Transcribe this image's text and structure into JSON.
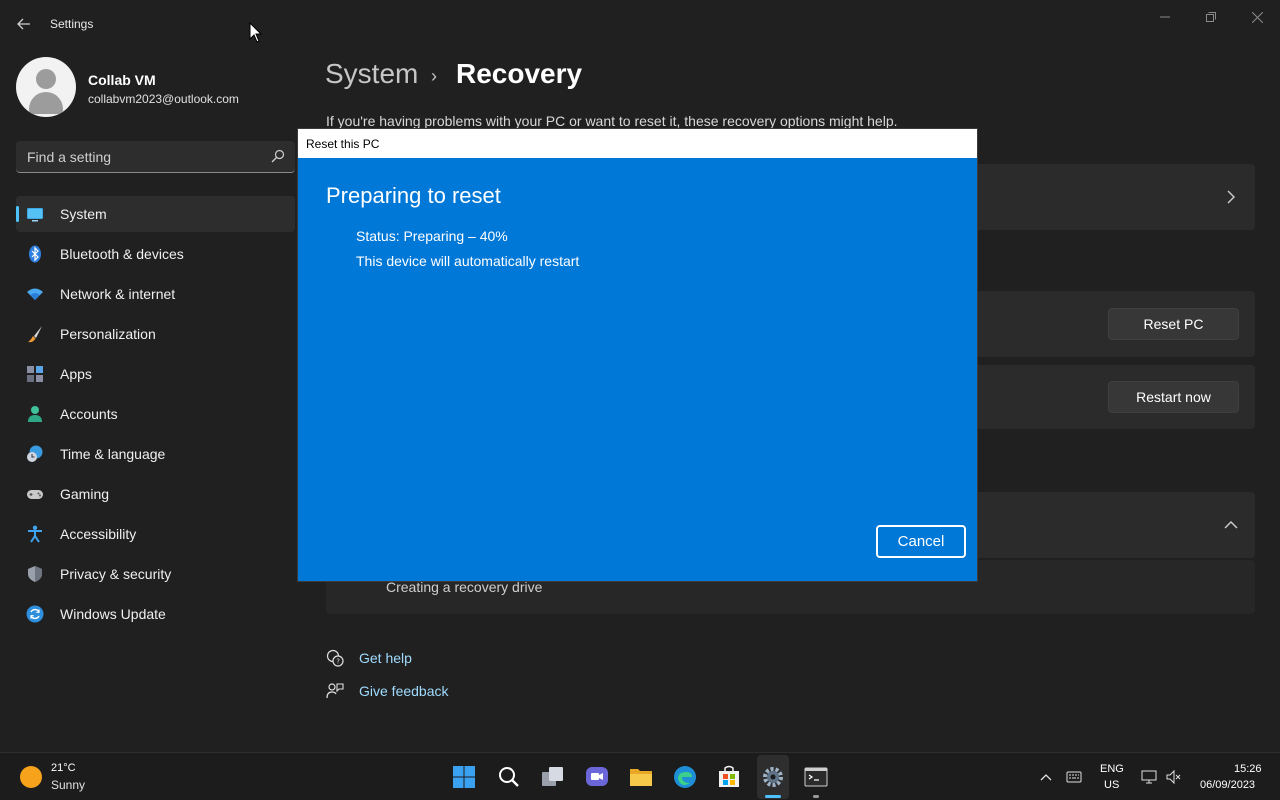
{
  "window": {
    "app_title": "Settings",
    "back_icon": "arrow-left-icon",
    "controls": [
      "minimize-icon",
      "maximize-icon",
      "close-icon"
    ]
  },
  "profile": {
    "name": "Collab VM",
    "email": "collabvm2023@outlook.com"
  },
  "search": {
    "placeholder": "Find a setting",
    "icon": "search-icon"
  },
  "sidebar": {
    "selected": "System",
    "accent": "#4cc2ff",
    "items": [
      {
        "label": "System",
        "icon": "monitor-icon"
      },
      {
        "label": "Bluetooth & devices",
        "icon": "bluetooth-icon"
      },
      {
        "label": "Network & internet",
        "icon": "wifi-icon"
      },
      {
        "label": "Personalization",
        "icon": "paintbrush-icon"
      },
      {
        "label": "Apps",
        "icon": "apps-icon"
      },
      {
        "label": "Accounts",
        "icon": "person-icon"
      },
      {
        "label": "Time & language",
        "icon": "clock-globe-icon"
      },
      {
        "label": "Gaming",
        "icon": "gamepad-icon"
      },
      {
        "label": "Accessibility",
        "icon": "accessibility-icon"
      },
      {
        "label": "Privacy & security",
        "icon": "shield-icon"
      },
      {
        "label": "Windows Update",
        "icon": "update-icon"
      }
    ]
  },
  "main": {
    "breadcrumb": {
      "parent": "System",
      "separator": "›",
      "current": "Recovery"
    },
    "intro": "If you're having problems with your PC or want to reset it, these recovery options might help.",
    "reset_button": "Reset PC",
    "restart_button": "Restart now",
    "sub_row": "Creating a recovery drive",
    "links": [
      {
        "label": "Get help",
        "icon": "help-chat-icon"
      },
      {
        "label": "Give feedback",
        "icon": "feedback-icon"
      }
    ]
  },
  "dialog": {
    "title": "Reset this PC",
    "heading": "Preparing to reset",
    "status": "Status: Preparing – 40%",
    "note": "This device will automatically restart",
    "cancel": "Cancel",
    "background": "#0078d7"
  },
  "taskbar": {
    "weather": {
      "temp": "21°C",
      "condition": "Sunny",
      "icon": "sun-icon"
    },
    "apps": [
      "windows-start-icon",
      "search-icon",
      "task-view-icon",
      "teams-chat-icon",
      "file-explorer-icon",
      "edge-icon",
      "store-icon",
      "settings-gear-icon",
      "terminal-icon"
    ],
    "active_app": "settings-gear-icon",
    "tray_icons": [
      "chevron-up-icon",
      "keyboard-icon",
      "display-network-icon",
      "volume-muted-icon"
    ],
    "lang_line1": "ENG",
    "lang_line2": "US",
    "time": "15:26",
    "date": "06/09/2023"
  }
}
